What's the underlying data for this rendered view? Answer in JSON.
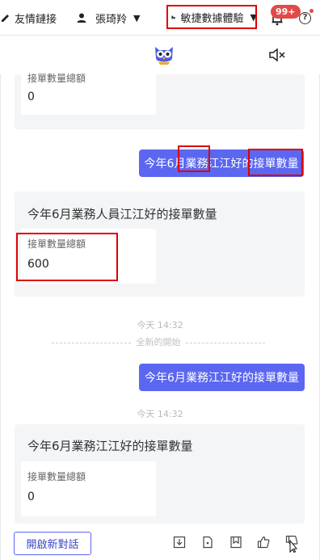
{
  "topbar": {
    "friend_links": "友情鏈接",
    "user_name": "張琦羚",
    "mode": "敏捷數據體驗",
    "notification_count": "99+",
    "help_label": "?"
  },
  "chat": {
    "messages": [
      {
        "type": "bot",
        "metric_label": "接單數量總額",
        "metric_value": "0"
      },
      {
        "type": "user",
        "text": "今年6月業務江江好的接單數量"
      },
      {
        "type": "bot",
        "title": "今年6月業務人員江江好的接單數量",
        "metric_label": "接單數量總額",
        "metric_value": "600"
      },
      {
        "type": "time",
        "text": "今天 14:32"
      },
      {
        "type": "divider",
        "text": "全新的開始"
      },
      {
        "type": "user",
        "text": "今年6月業務江江好的接單數量"
      },
      {
        "type": "time",
        "text": "今天 14:32"
      },
      {
        "type": "bot",
        "title": "今年6月業務江江好的接單數量",
        "metric_label": "接單數量總額",
        "metric_value": "0"
      }
    ]
  },
  "footer": {
    "new_chat_label": "開啟新對話"
  },
  "colors": {
    "accent": "#5b67f0",
    "highlight": "#e00000",
    "badge": "#e24a4a"
  },
  "icons": [
    "edit-icon",
    "user-icon",
    "building-icon",
    "bell-icon",
    "help-icon",
    "owl-avatar-icon",
    "mute-icon",
    "download-icon",
    "copy-icon",
    "bookmark-icon",
    "thumbs-up-icon",
    "thumbs-down-icon",
    "cursor-icon"
  ]
}
